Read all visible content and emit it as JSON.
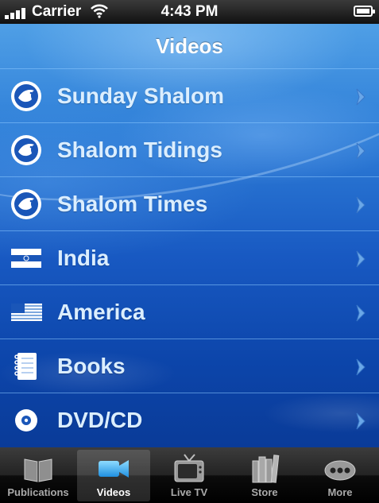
{
  "status_bar": {
    "carrier": "Carrier",
    "time": "4:43 PM"
  },
  "nav": {
    "title": "Videos"
  },
  "list": {
    "items": [
      {
        "label": "Sunday Shalom",
        "icon": "dove-logo-icon"
      },
      {
        "label": "Shalom Tidings",
        "icon": "dove-logo-icon"
      },
      {
        "label": "Shalom Times",
        "icon": "dove-logo-icon"
      },
      {
        "label": "India",
        "icon": "india-flag-icon"
      },
      {
        "label": "America",
        "icon": "us-flag-icon"
      },
      {
        "label": "Books",
        "icon": "notebook-icon"
      },
      {
        "label": "DVD/CD",
        "icon": "disc-icon"
      }
    ]
  },
  "tabbar": {
    "tabs": [
      {
        "label": "Publications",
        "icon": "open-book-icon",
        "active": false
      },
      {
        "label": "Videos",
        "icon": "video-camera-icon",
        "active": true
      },
      {
        "label": "Live TV",
        "icon": "tv-icon",
        "active": false
      },
      {
        "label": "Store",
        "icon": "books-icon",
        "active": false
      },
      {
        "label": "More",
        "icon": "more-dots-icon",
        "active": false
      }
    ]
  },
  "colors": {
    "row_text": "#dbeeff",
    "accent_blue": "#1859c2",
    "tab_active_bg": "#3a3a3a"
  }
}
